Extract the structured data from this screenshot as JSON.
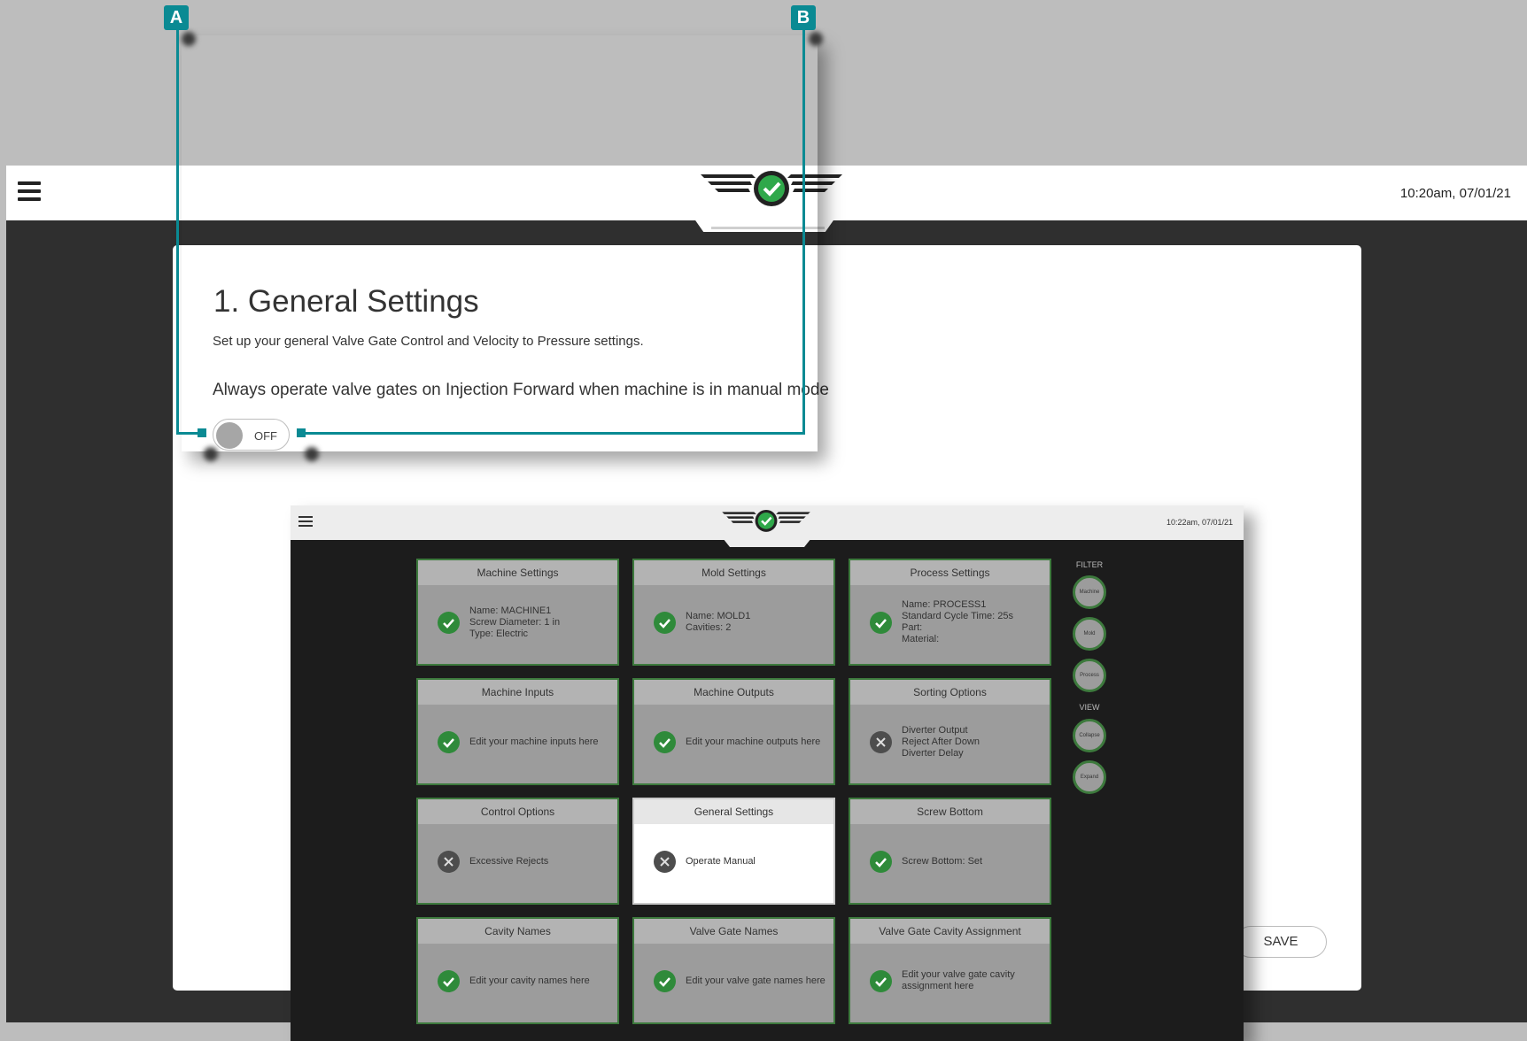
{
  "app": {
    "datetime": "10:20am, 07/01/21",
    "icons": {
      "menu": "hamburger-icon",
      "logo": "status-check-logo"
    }
  },
  "card": {
    "title": "1. General Settings",
    "subtitle": "Set up your general Valve Gate Control and Velocity to Pressure settings.",
    "question": "Always operate valve gates on Injection Forward when machine is in manual mode",
    "toggle_label": "OFF",
    "save_label": "SAVE"
  },
  "callouts": {
    "a": "A",
    "b": "B"
  },
  "inset": {
    "datetime": "10:22am, 07/01/21",
    "tiles": [
      {
        "title": "Machine Settings",
        "status": "ok",
        "lines": [
          "Name: MACHINE1",
          "Screw Diameter: 1 in",
          "Type: Electric"
        ]
      },
      {
        "title": "Mold Settings",
        "status": "ok",
        "lines": [
          "Name: MOLD1",
          "Cavities: 2"
        ]
      },
      {
        "title": "Process Settings",
        "status": "ok",
        "lines": [
          "Name: PROCESS1",
          "Standard Cycle Time: 25s",
          "Part:",
          "Material:"
        ]
      },
      {
        "title": "Machine Inputs",
        "status": "ok",
        "lines": [
          "Edit your machine inputs here"
        ]
      },
      {
        "title": "Machine Outputs",
        "status": "ok",
        "lines": [
          "Edit your machine outputs here"
        ]
      },
      {
        "title": "Sorting Options",
        "status": "bad",
        "lines": [
          "Diverter Output",
          "Reject After Down",
          "Diverter Delay"
        ]
      },
      {
        "title": "Control Options",
        "status": "bad",
        "lines": [
          "Excessive Rejects"
        ]
      },
      {
        "title": "General Settings",
        "status": "bad",
        "lines": [
          "Operate Manual"
        ]
      },
      {
        "title": "Screw Bottom",
        "status": "ok",
        "lines": [
          "Screw Bottom: Set"
        ]
      },
      {
        "title": "Cavity Names",
        "status": "ok",
        "lines": [
          "Edit your cavity names here"
        ]
      },
      {
        "title": "Valve Gate Names",
        "status": "ok",
        "lines": [
          "Edit your valve gate names here"
        ]
      },
      {
        "title": "Valve Gate Cavity Assignment",
        "status": "ok",
        "lines": [
          "Edit your valve gate cavity",
          "assignment here"
        ]
      }
    ],
    "filter_label": "FILTER",
    "filter_buttons": [
      "Machine",
      "Mold",
      "Process"
    ],
    "view_label": "VIEW",
    "view_buttons": [
      "Collapse",
      "Expand"
    ]
  },
  "colors": {
    "accent": "#0a8a93",
    "ok": "#2f8a3a",
    "tile_border": "#3d7a3d"
  }
}
